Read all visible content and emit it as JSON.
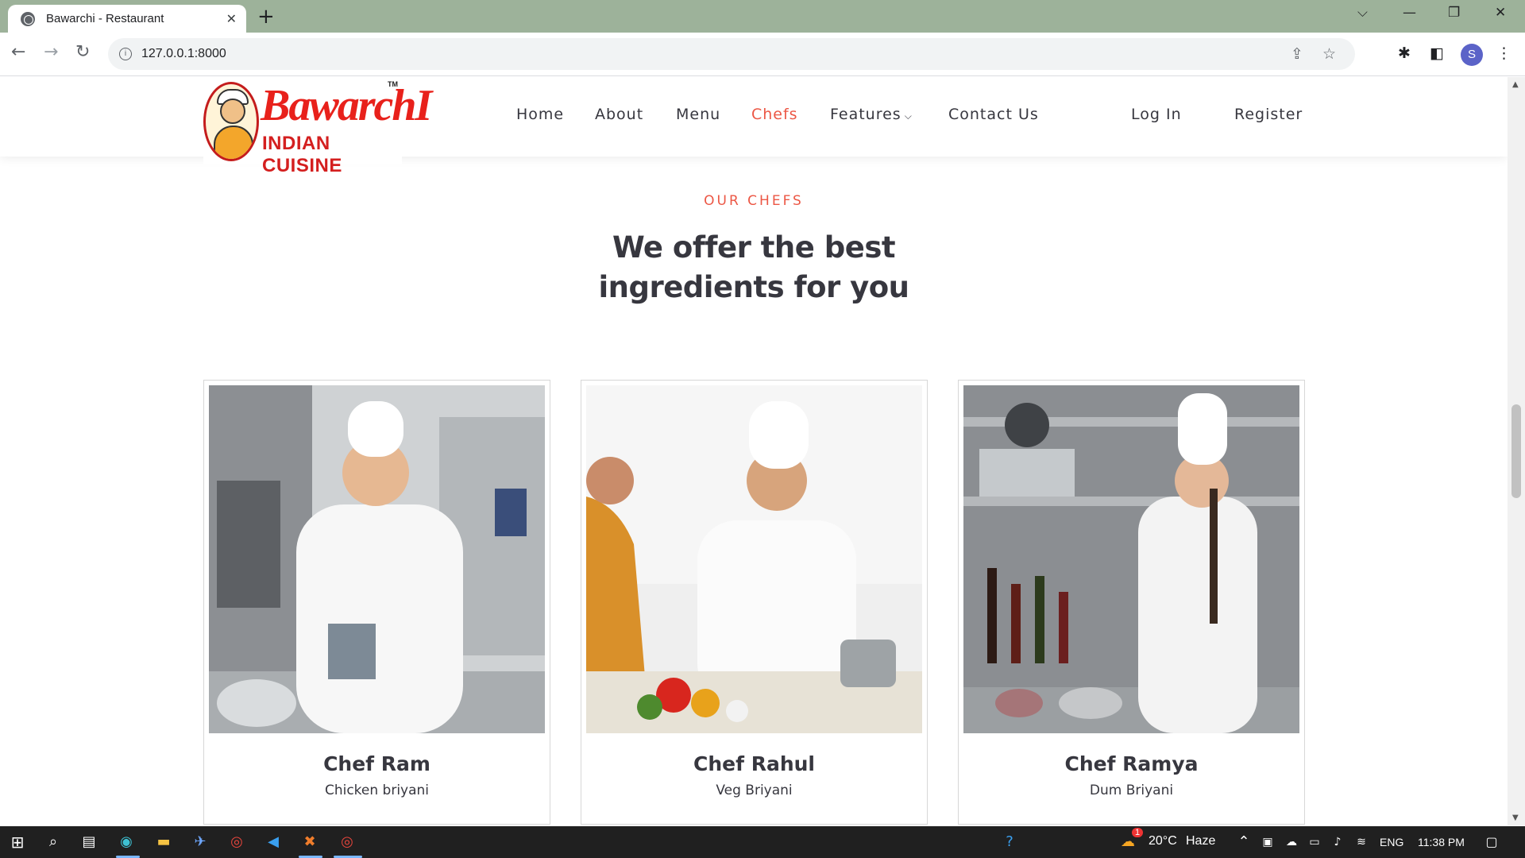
{
  "browser": {
    "tab_title": "Bawarchi - Restaurant",
    "url": "127.0.0.1:8000",
    "profile_initial": "S"
  },
  "site": {
    "logo": {
      "brand": "BawarchI",
      "subtitle": "INDIAN CUISINE",
      "tm": "TM"
    },
    "nav": {
      "home": "Home",
      "about": "About",
      "menu": "Menu",
      "chefs": "Chefs",
      "features": "Features",
      "contact": "Contact Us",
      "login": "Log In",
      "register": "Register"
    },
    "active_nav": "Chefs",
    "accent_color": "#ec5745",
    "text_color": "#37373f"
  },
  "section": {
    "kicker": "OUR CHEFS",
    "title_line1": "We offer the best",
    "title_line2": "ingredients for you"
  },
  "chefs": [
    {
      "name": "Chef Ram",
      "dish": "Chicken briyani"
    },
    {
      "name": "Chef Rahul",
      "dish": "Veg Briyani"
    },
    {
      "name": "Chef Ramya",
      "dish": "Dum Briyani"
    }
  ],
  "taskbar": {
    "weather_temp": "20°C",
    "weather_desc": "Haze",
    "language": "ENG",
    "time": "11:38 PM",
    "notification_count": "1"
  },
  "icons": {
    "tab_favicon": "globe-icon",
    "start": "windows-start-icon",
    "search": "search-icon",
    "task_view": "task-view-icon"
  }
}
